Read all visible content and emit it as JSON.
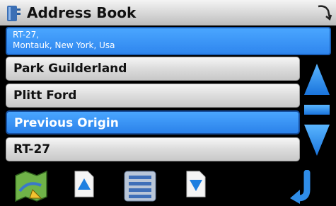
{
  "header": {
    "title": "Address Book"
  },
  "address": {
    "line1": "RT-27,",
    "line2": "Montauk, New York, Usa"
  },
  "list": {
    "items": [
      {
        "label": "Park Guilderland"
      },
      {
        "label": "Plitt Ford"
      },
      {
        "label": "Previous Origin"
      },
      {
        "label": "RT-27"
      }
    ]
  },
  "colors": {
    "accent": "#2f86ee",
    "scroll_accent": "#1e90ff",
    "selected_border": "#174f9e"
  },
  "icons": [
    "book-icon",
    "back-arrow-icon",
    "scroll-up-icon",
    "scroll-down-icon",
    "map-icon",
    "page-up-icon",
    "list-view-icon",
    "page-down-icon",
    "return-icon"
  ]
}
